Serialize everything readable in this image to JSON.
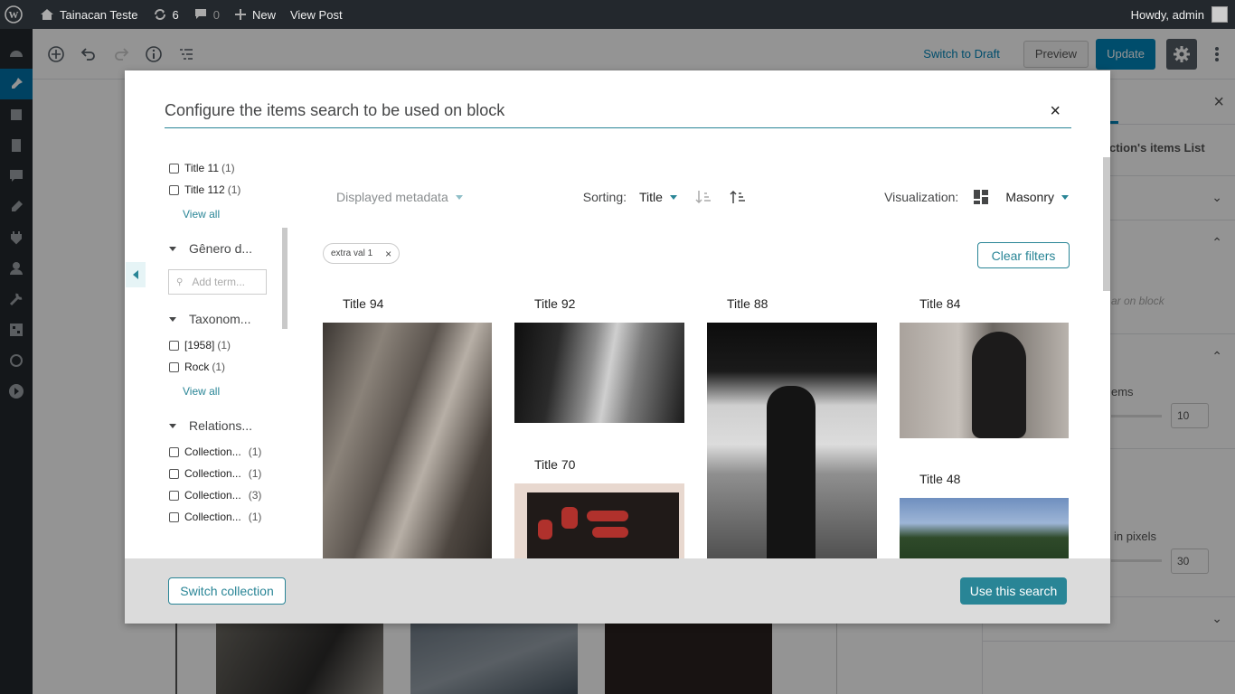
{
  "admin_bar": {
    "site_name": "Tainacan Teste",
    "updates_count": "6",
    "comments_count": "0",
    "new_label": "New",
    "view_post_label": "View Post",
    "howdy": "Howdy, admin"
  },
  "editor_toolbar": {
    "switch_to_draft": "Switch to Draft",
    "preview": "Preview",
    "update": "Update"
  },
  "sidebar_panel": {
    "close": "×",
    "title_fragment": "ction's items List",
    "placeholder_fragment": "ar on block",
    "items_label_fragment": "ems",
    "items_value": "10",
    "pixels_label_fragment": "in pixels",
    "pixels_value": "30"
  },
  "modal": {
    "title": "Configure the items search to be used on block",
    "close": "×",
    "filters": {
      "top_options": [
        {
          "label": "Title 11",
          "count": "(1)"
        },
        {
          "label": "Title 112",
          "count": "(1)"
        }
      ],
      "view_all": "View all",
      "genero": {
        "label": "Gênero d...",
        "placeholder": "Add term..."
      },
      "taxonomy": {
        "label": "Taxonom...",
        "options": [
          {
            "label": "[1958]",
            "count": "(1)"
          },
          {
            "label": "Rock",
            "count": "(1)"
          }
        ]
      },
      "relations": {
        "label": "Relations...",
        "options": [
          {
            "label": "Collection...",
            "count": "(1)"
          },
          {
            "label": "Collection...",
            "count": "(1)"
          },
          {
            "label": "Collection...",
            "count": "(3)"
          },
          {
            "label": "Collection...",
            "count": "(1)"
          }
        ]
      }
    },
    "controls": {
      "displayed_metadata": "Displayed metadata",
      "sorting_label": "Sorting:",
      "sorting_value": "Title",
      "visualization_label": "Visualization:",
      "visualization_value": "Masonry"
    },
    "active_filter": {
      "label": "extra val 1",
      "remove": "×"
    },
    "clear_filters": "Clear filters",
    "items": [
      {
        "title": "Title 94"
      },
      {
        "title": "Title 92"
      },
      {
        "title": "Title 88"
      },
      {
        "title": "Title 84"
      },
      {
        "title": "Title 70"
      },
      {
        "title": "Title 48"
      }
    ],
    "switch_collection": "Switch collection",
    "use_this_search": "Use this search"
  }
}
